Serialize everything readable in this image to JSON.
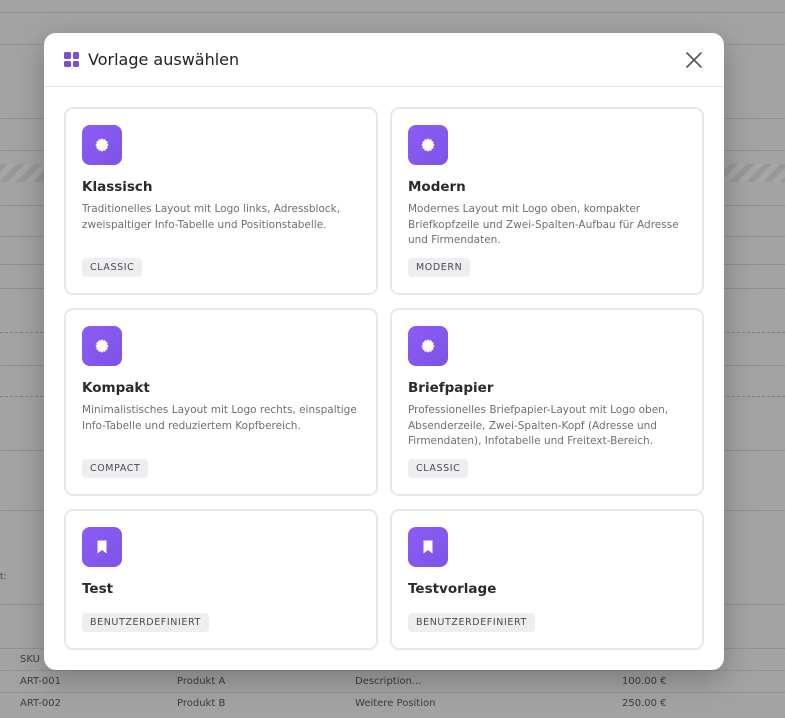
{
  "modal": {
    "title": "Vorlage auswählen",
    "icon": "grid-icon",
    "close_icon": "close-icon"
  },
  "templates": [
    {
      "name": "Klassisch",
      "description": "Traditionelles Layout mit Logo links, Adressblock, zweispaltiger Info-Tabelle und Positionstabelle.",
      "badge": "CLASSIC",
      "icon": "seal-icon"
    },
    {
      "name": "Modern",
      "description": "Modernes Layout mit Logo oben, kompakter Briefkopfzeile und Zwei-Spalten-Aufbau für Adresse und Firmendaten.",
      "badge": "MODERN",
      "icon": "seal-icon"
    },
    {
      "name": "Kompakt",
      "description": "Minimalistisches Layout mit Logo rechts, einspaltige Info-Tabelle und reduziertem Kopfbereich.",
      "badge": "COMPACT",
      "icon": "seal-icon"
    },
    {
      "name": "Briefpapier",
      "description": "Professionelles Briefpapier-Layout mit Logo oben, Absenderzeile, Zwei-Spalten-Kopf (Adresse und Firmendaten), Infotabelle und Freitext-Bereich.",
      "badge": "CLASSIC",
      "icon": "seal-icon"
    },
    {
      "name": "Test",
      "description": "",
      "badge": "BENUTZERDEFINIERT",
      "icon": "bookmark-icon"
    },
    {
      "name": "Testvorlage",
      "description": "",
      "badge": "BENUTZERDEFINIERT",
      "icon": "bookmark-icon"
    }
  ],
  "background": {
    "side_label": "t:",
    "table": {
      "header": [
        "SKU",
        "",
        "",
        ""
      ],
      "rows": [
        [
          "ART-001",
          "Produkt A",
          "Description...",
          "100.00 €"
        ],
        [
          "ART-002",
          "Produkt B",
          "Weitere Position",
          "250.00 €"
        ]
      ]
    }
  },
  "colors": {
    "accent": "#7c4ddb",
    "icon_gradient_start": "#8b5cf6",
    "icon_gradient_end": "#7e53e6"
  }
}
